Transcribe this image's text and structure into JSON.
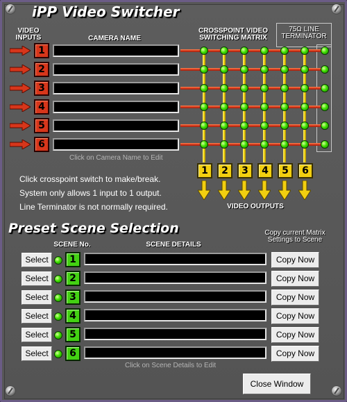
{
  "titles": {
    "main": "iPP Video Switcher",
    "preset": "Preset Scene Selection"
  },
  "headers": {
    "video_inputs_1": "VIDEO",
    "video_inputs_2": "INPUTS",
    "camera_name": "CAMERA NAME",
    "matrix_1": "CROSSPOINT VIDEO",
    "matrix_2": "SWITCHING MATRIX",
    "terminator_1": "75Ω  LINE",
    "terminator_2": "TERMINATOR",
    "video_outputs": "VIDEO OUTPUTS",
    "scene_no": "SCENE No.",
    "scene_details": "SCENE DETAILS",
    "copy_1": "Copy current Matrix",
    "copy_2": "Settings to Scene"
  },
  "inputs": [
    "1",
    "2",
    "3",
    "4",
    "5",
    "6"
  ],
  "outputs": [
    "1",
    "2",
    "3",
    "4",
    "5",
    "6"
  ],
  "camera_names": [
    "",
    "",
    "",
    "",
    "",
    ""
  ],
  "hints": {
    "camera": "Click on Camera Name to Edit",
    "scene": "Click on Scene Details to Edit"
  },
  "info": [
    "Click crosspoint switch to make/break.",
    "System only allows 1 input to 1 output.",
    "Line Terminator is not normally required."
  ],
  "scenes": [
    {
      "num": "1",
      "select": "Select",
      "copy": "Copy Now",
      "details": ""
    },
    {
      "num": "2",
      "select": "Select",
      "copy": "Copy Now",
      "details": ""
    },
    {
      "num": "3",
      "select": "Select",
      "copy": "Copy Now",
      "details": ""
    },
    {
      "num": "4",
      "select": "Select",
      "copy": "Copy Now",
      "details": ""
    },
    {
      "num": "5",
      "select": "Select",
      "copy": "Copy Now",
      "details": ""
    },
    {
      "num": "6",
      "select": "Select",
      "copy": "Copy Now",
      "details": ""
    }
  ],
  "close_button": "Close Window",
  "colors": {
    "input_red": "#d7361b",
    "output_yellow": "#f2cf10",
    "scene_green": "#43d113",
    "crosspoint_green": "#3ee000",
    "panel_grey": "#575757",
    "frame_purple": "#6b5c86"
  }
}
